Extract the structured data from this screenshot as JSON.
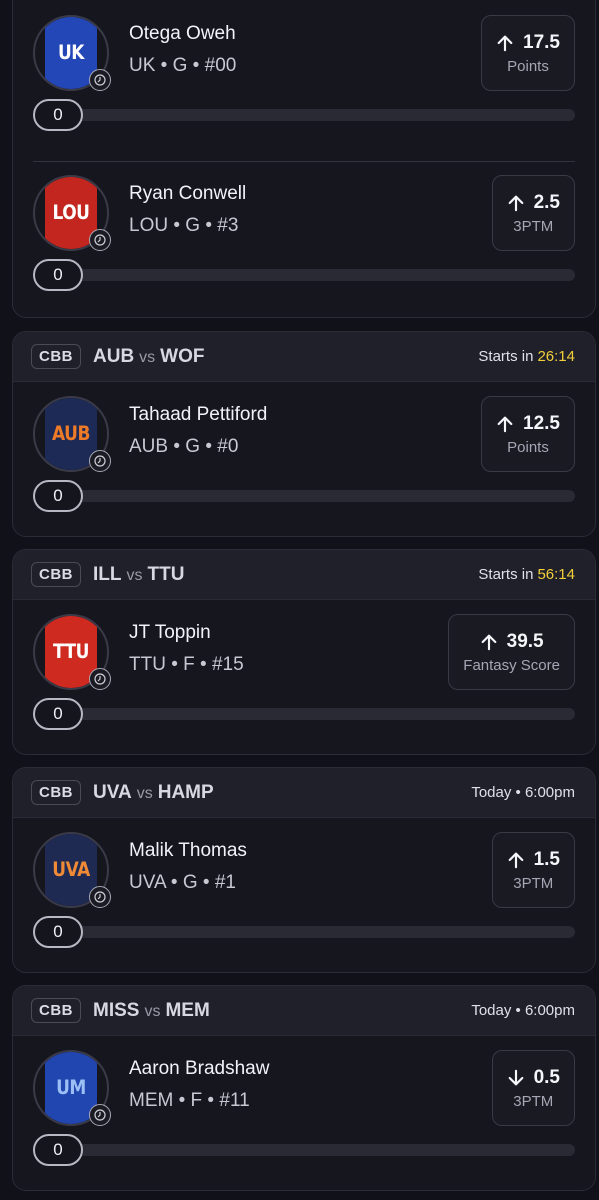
{
  "cards": [
    {
      "players": [
        {
          "name": "Otega Oweh",
          "team": "UK",
          "position": "G",
          "number": "#00",
          "jersey_label": "UK",
          "jersey_color": "#2447b8",
          "direction": "up",
          "line": "17.5",
          "stat": "Points",
          "progress_value": "0",
          "progress_fraction": 0
        },
        {
          "name": "Ryan Conwell",
          "team": "LOU",
          "position": "G",
          "number": "#3",
          "jersey_label": "LOU",
          "jersey_color": "#c3261f",
          "direction": "up",
          "line": "2.5",
          "stat": "3PTM",
          "progress_value": "0",
          "progress_fraction": 0
        }
      ]
    },
    {
      "league": "CBB",
      "team_a": "AUB",
      "vs": "vs",
      "team_b": "WOF",
      "time_prefix": "Starts in",
      "countdown": "26:14",
      "players": [
        {
          "name": "Tahaad Pettiford",
          "team": "AUB",
          "position": "G",
          "number": "#0",
          "jersey_label": "AUB",
          "jersey_color": "#1d2a55",
          "jersey_text_color": "#ef7b28",
          "direction": "up",
          "line": "12.5",
          "stat": "Points",
          "progress_value": "0",
          "progress_fraction": 0
        }
      ]
    },
    {
      "league": "CBB",
      "team_a": "ILL",
      "vs": "vs",
      "team_b": "TTU",
      "time_prefix": "Starts in",
      "countdown": "56:14",
      "players": [
        {
          "name": "JT Toppin",
          "team": "TTU",
          "position": "F",
          "number": "#15",
          "jersey_label": "TTU",
          "jersey_color": "#cf2a20",
          "direction": "up",
          "line": "39.5",
          "stat": "Fantasy Score",
          "progress_value": "0",
          "progress_fraction": 0
        }
      ]
    },
    {
      "league": "CBB",
      "team_a": "UVA",
      "vs": "vs",
      "team_b": "HAMP",
      "time_prefix": "Today • 6:00pm",
      "countdown": "",
      "players": [
        {
          "name": "Malik Thomas",
          "team": "UVA",
          "position": "G",
          "number": "#1",
          "jersey_label": "UVA",
          "jersey_color": "#1f2a52",
          "jersey_text_color": "#f08a36",
          "direction": "up",
          "line": "1.5",
          "stat": "3PTM",
          "progress_value": "0",
          "progress_fraction": 0
        }
      ]
    },
    {
      "league": "CBB",
      "team_a": "MISS",
      "vs": "vs",
      "team_b": "MEM",
      "time_prefix": "Today • 6:00pm",
      "countdown": "",
      "players": [
        {
          "name": "Aaron Bradshaw",
          "team": "MEM",
          "position": "F",
          "number": "#11",
          "jersey_label": "UM",
          "jersey_color": "#2146b0",
          "jersey_text_color": "#9cc0f5",
          "direction": "down",
          "line": "0.5",
          "stat": "3PTM",
          "progress_value": "0",
          "progress_fraction": 0
        }
      ]
    }
  ]
}
